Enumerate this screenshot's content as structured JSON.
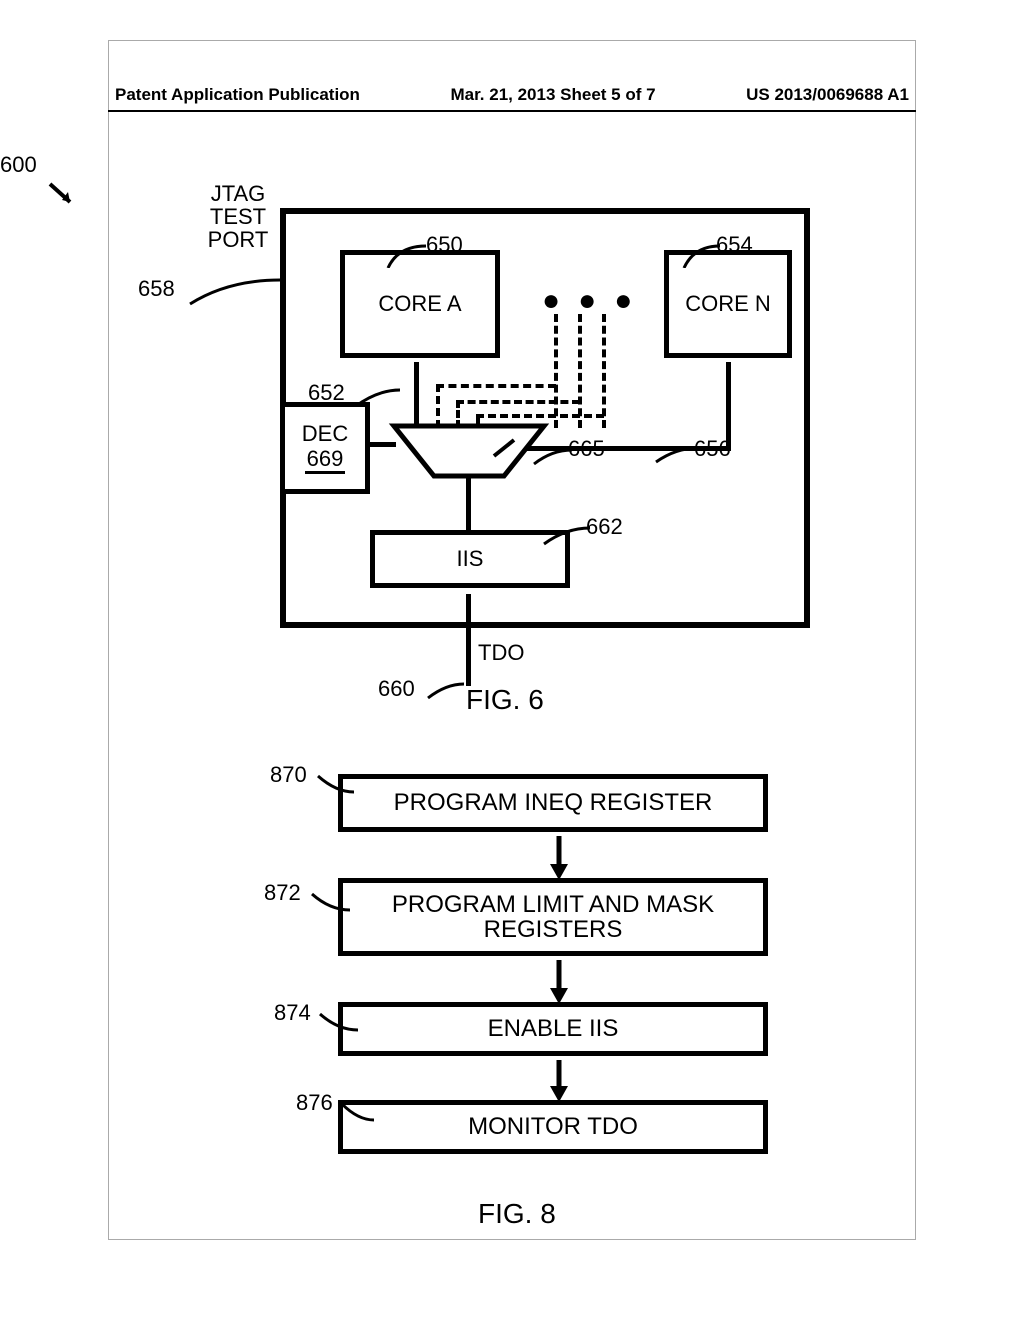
{
  "header": {
    "left": "Patent Application Publication",
    "center": "Mar. 21, 2013  Sheet 5 of 7",
    "right": "US 2013/0069688 A1"
  },
  "fig6": {
    "ref_chip": "600",
    "jtag_label_l1": "JTAG",
    "jtag_label_l2": "TEST",
    "jtag_label_l3": "PORT",
    "ref_jtag": "658",
    "coreA": "CORE A",
    "coreA_ref": "650",
    "coreN": "CORE N",
    "coreN_ref": "654",
    "ref_coreA_out": "652",
    "dec_label": "DEC",
    "dec_id": "669",
    "mux_ref": "665",
    "coreN_out_ref": "656",
    "iis_label": "IIS",
    "iis_ref": "662",
    "tdo_label": "TDO",
    "tdo_ref": "660",
    "caption": "FIG. 6"
  },
  "fig8": {
    "steps": {
      "s870": {
        "ref": "870",
        "label": "PROGRAM INEQ REGISTER"
      },
      "s872": {
        "ref": "872",
        "label_l1": "PROGRAM LIMIT AND MASK",
        "label_l2": "REGISTERS"
      },
      "s874": {
        "ref": "874",
        "label": "ENABLE IIS"
      },
      "s876": {
        "ref": "876",
        "label": "MONITOR TDO"
      }
    },
    "caption": "FIG. 8"
  }
}
